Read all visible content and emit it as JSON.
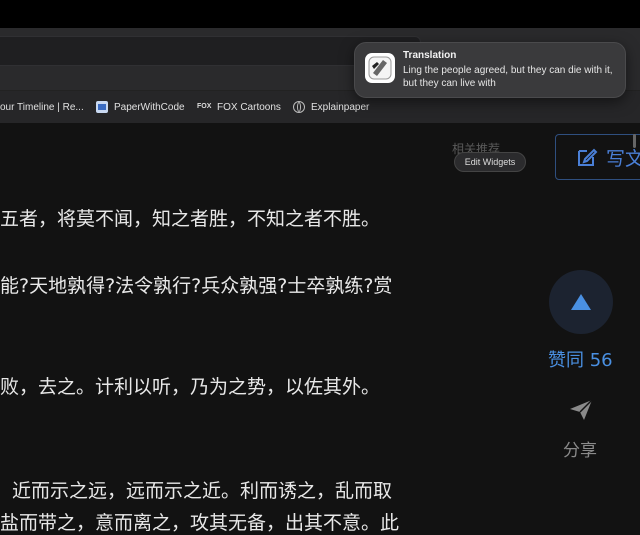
{
  "notification": {
    "title": "Translation",
    "body": "Ling the people agreed, but they can die with it, but they can live with"
  },
  "bookmarks": [
    {
      "label": "our Timeline | Re...",
      "icon": "none"
    },
    {
      "label": "PaperWithCode",
      "icon": "paperwithcode-icon"
    },
    {
      "label": "FOX Cartoons",
      "icon": "fox-icon",
      "icon_text": "FOX"
    },
    {
      "label": "Explainpaper",
      "icon": "globe-icon"
    }
  ],
  "widgets": {
    "edit_label": "Edit Widgets",
    "behind_text": "相关推荐"
  },
  "write_button": {
    "label": "写文"
  },
  "article": {
    "lines": [
      "五者，将莫不闻，知之者胜，不知之者不胜。",
      "能?天地孰得?法令孰行?兵众孰强?士卒孰练?赏",
      "败，去之。计利以听，乃为之势，以佐其外。",
      "近而示之远，远而示之近。利而诱之，乱而取",
      "盐而带之，意而离之，攻其无备，出其不意。此"
    ]
  },
  "vote": {
    "label": "赞同 56",
    "color": "#4a90e2"
  },
  "share": {
    "label": "分享"
  },
  "colors": {
    "background": "#121212",
    "accent": "#4a90e2",
    "toolbar": "#2a2a2c"
  }
}
